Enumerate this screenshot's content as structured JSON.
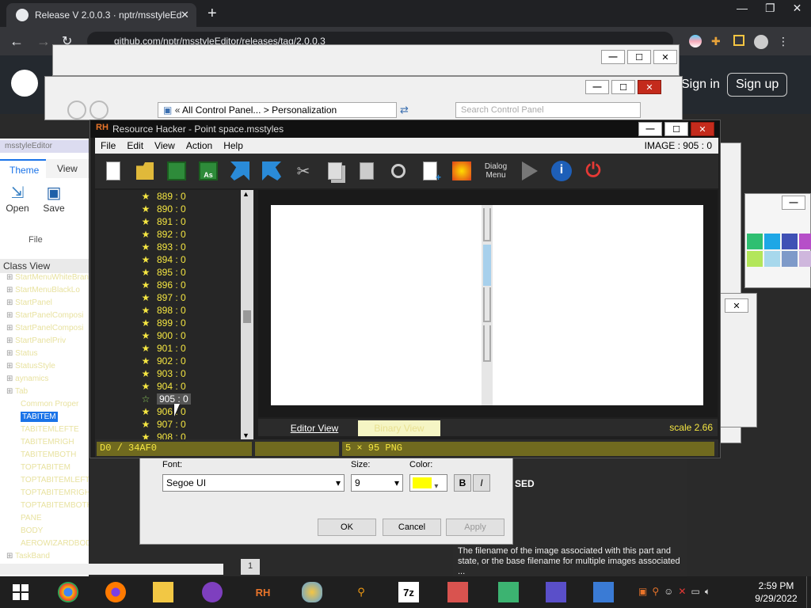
{
  "browser": {
    "tab_title": "Release V 2.0.0.3 · nptr/msstyleEd",
    "url": "github.com/nptr/msstyleEditor/releases/tag/2.0.0.3",
    "sign_in": "Sign in",
    "sign_up": "Sign up"
  },
  "control_panel": {
    "breadcrumb_all": "All Control Panel...",
    "breadcrumb_sep": ">",
    "breadcrumb_current": "Personalization",
    "search_placeholder": "Search Control Panel"
  },
  "editor": {
    "tabs": [
      "Theme",
      "View"
    ],
    "open_label": "Open",
    "save_label": "Save",
    "group_label": "File",
    "class_view_label": "Class View",
    "class_items": [
      "StartMenuWhiteBrand",
      "StartMenuBlackLo",
      "StartPanel",
      "StartPanelComposi",
      "StartPanelComposi",
      "StartPanelPriv",
      "Status",
      "StatusStyle",
      "aynamics",
      "Tab",
      "Common Proper",
      "TABITEM",
      "TABITEMLEFTE",
      "TABITEMRIGH",
      "TABITEMBOTH",
      "TOPTABITEM",
      "TOPTABITEMLEFTEDGE",
      "TOPTABITEMRIGHTEDGE",
      "TOPTABITEMBOTHEDGE",
      "PANE",
      "BODY",
      "AEROWIZARDBODY",
      "TaskBand"
    ],
    "selected_class": "TABITEM",
    "page_number": "1",
    "property_heading": "SED",
    "description": "The filename of the image associated with this part and state, or the base filename for multiple images associated ..."
  },
  "font_dialog": {
    "font_label": "Font:",
    "font_value": "Segoe UI",
    "size_label": "Size:",
    "size_value": "9",
    "color_label": "Color:",
    "color_value": "#ffff00",
    "bold_label": "B",
    "italic_label": "I",
    "ok_label": "OK",
    "cancel_label": "Cancel",
    "apply_label": "Apply"
  },
  "resource_hacker": {
    "title": "Resource Hacker - Point space.msstyles",
    "logo": "RH",
    "menu": [
      "File",
      "Edit",
      "View",
      "Action",
      "Help"
    ],
    "resource_id": "IMAGE : 905 : 0",
    "dialog_menu_label_1": "Dialog",
    "dialog_menu_label_2": "Menu",
    "tree_items": [
      "889 : 0",
      "890 : 0",
      "891 : 0",
      "892 : 0",
      "893 : 0",
      "894 : 0",
      "895 : 0",
      "896 : 0",
      "897 : 0",
      "898 : 0",
      "899 : 0",
      "900 : 0",
      "901 : 0",
      "902 : 0",
      "903 : 0",
      "904 : 0",
      "905 : 0",
      "906 : 0",
      "907 : 0",
      "908 : 0"
    ],
    "selected_index": 16,
    "editor_view_label": "Editor View",
    "binary_view_label": "Binary View",
    "scale_label": "scale 2.66",
    "status_offset": "D0 / 34AF0",
    "status_info": "5 × 95  PNG",
    "image_fill_fraction": 0.33
  },
  "taskbar": {
    "time": "2:59 PM",
    "date": "9/29/2022",
    "apps": [
      "chrome-icon",
      "firefox-icon",
      "explorer-icon",
      "yahoo-messenger-icon",
      "resource-hacker-icon",
      "paint-icon",
      "search-tool-icon",
      "7zip-icon",
      "theme-tool-icon",
      "rubik-cube-icon",
      "visual-studio-icon",
      "display-settings-icon"
    ]
  },
  "colors": {
    "tree_text": "#f5e642",
    "status_bg": "#706a1f",
    "accent_blue": "#1a73e8",
    "close_red": "#c42b1c"
  }
}
